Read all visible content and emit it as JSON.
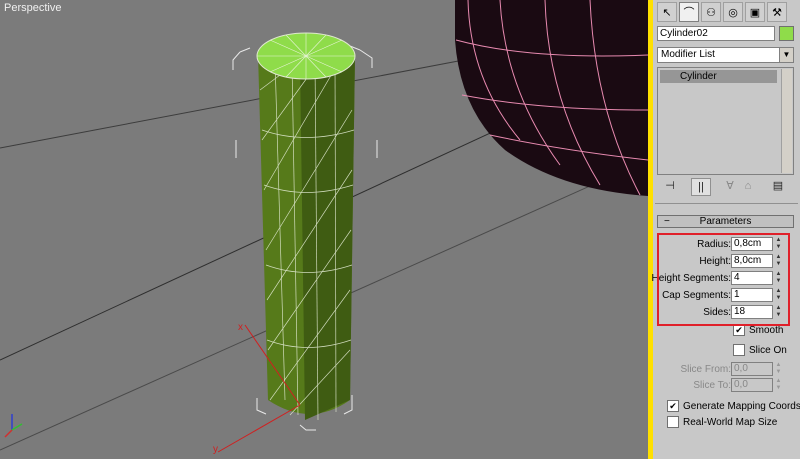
{
  "viewport": {
    "label": "Perspective",
    "background": "#7b7b7b",
    "border_color": "#ffe000"
  },
  "command_panel": {
    "tabs": [
      {
        "name": "create-tab-icon",
        "glyph": "↖"
      },
      {
        "name": "modify-tab-icon",
        "glyph": "⌒"
      },
      {
        "name": "hierarchy-tab-icon",
        "glyph": "⚇"
      },
      {
        "name": "motion-tab-icon",
        "glyph": "◎"
      },
      {
        "name": "display-tab-icon",
        "glyph": "▣"
      },
      {
        "name": "utilities-tab-icon",
        "glyph": "⚒"
      }
    ],
    "object_name": "Cylinder02",
    "object_color": "#8fdc4a",
    "modifier_list": "Modifier List",
    "stack_item": "Cylinder",
    "stack_tools": [
      {
        "name": "pin-stack-icon",
        "glyph": "⊣"
      },
      {
        "name": "show-end-result-icon",
        "glyph": "|||"
      },
      {
        "name": "make-unique-icon",
        "glyph": "∀"
      },
      {
        "name": "remove-modifier-icon",
        "glyph": "⌂"
      },
      {
        "name": "configure-modifier-sets-icon",
        "glyph": "▤"
      }
    ]
  },
  "parameters": {
    "title": "Parameters",
    "collapse": "−",
    "fields": [
      {
        "label": "Radius:",
        "value": "0,8cm"
      },
      {
        "label": "Height:",
        "value": "8,0cm"
      },
      {
        "label": "Height Segments:",
        "value": "4"
      },
      {
        "label": "Cap Segments:",
        "value": "1"
      },
      {
        "label": "Sides:",
        "value": "18"
      }
    ],
    "smooth": {
      "label": "Smooth",
      "checked": true
    },
    "slice_on": {
      "label": "Slice On",
      "checked": false
    },
    "slice_from": {
      "label": "Slice From:",
      "value": "0,0"
    },
    "slice_to": {
      "label": "Slice To:",
      "value": "0,0"
    },
    "gen_mapping": {
      "label": "Generate Mapping Coords.",
      "checked": true
    },
    "real_world": {
      "label": "Real-World Map Size",
      "checked": false
    }
  }
}
